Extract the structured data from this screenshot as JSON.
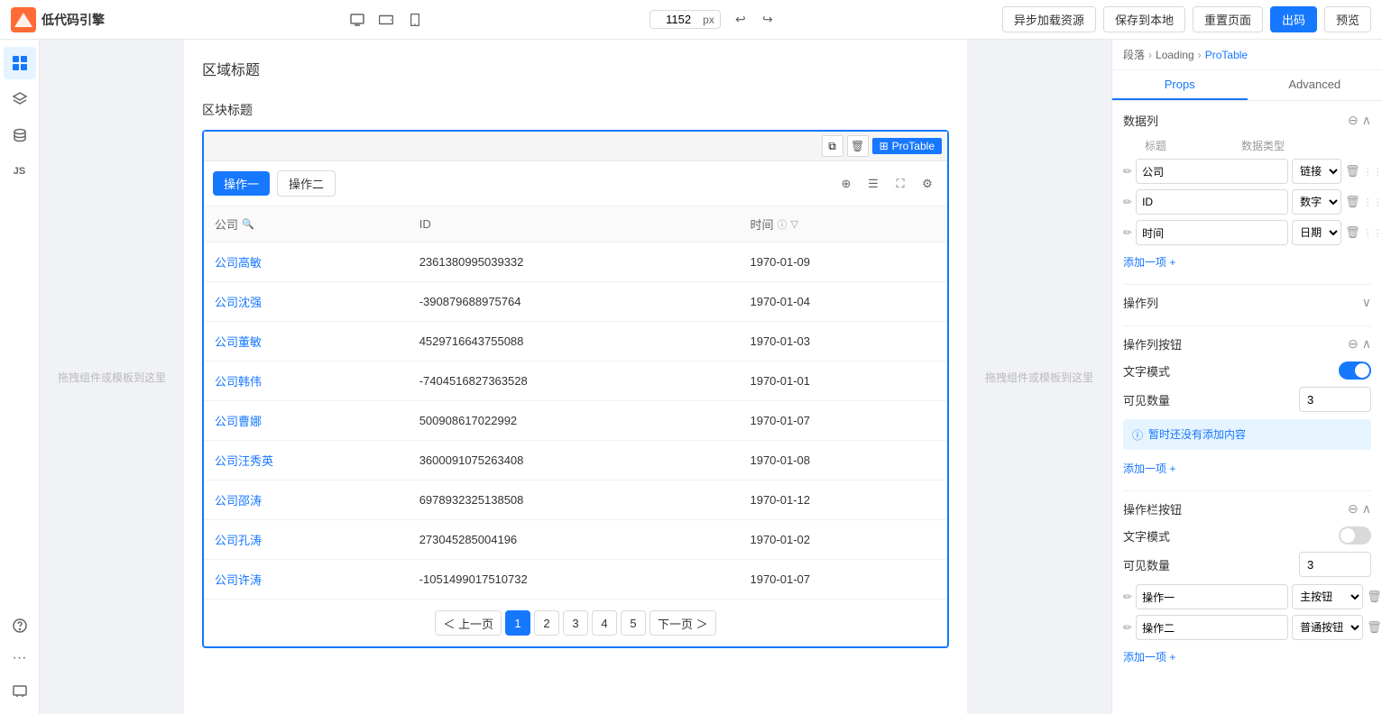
{
  "app": {
    "logo_text": "低代码引擎",
    "width_value": "1152",
    "width_unit": "px"
  },
  "toolbar": {
    "async_load": "异步加载资源",
    "save_local": "保存到本地",
    "reset_page": "重置页面",
    "export": "出码",
    "preview": "预览",
    "undo_icon": "↩",
    "redo_icon": "↪"
  },
  "breadcrumb": {
    "items": [
      "段落",
      "Loading",
      "ProTable"
    ]
  },
  "tabs": {
    "props": "Props",
    "advanced": "Advanced"
  },
  "canvas": {
    "drop_zone_text": "拖拽组件或模板到这里",
    "section_title": "区域标题",
    "block_title": "区块标题"
  },
  "pro_table": {
    "label": "ProTable",
    "btn1": "操作一",
    "btn2": "操作二",
    "columns": [
      {
        "key": "company",
        "title": "公司",
        "search": true
      },
      {
        "key": "id",
        "title": "ID"
      },
      {
        "key": "time",
        "title": "时间"
      }
    ],
    "rows": [
      {
        "company": "公司高敏",
        "id": "2361380995039332",
        "time": "1970-01-09"
      },
      {
        "company": "公司沈强",
        "id": "-390879688975764",
        "time": "1970-01-04"
      },
      {
        "company": "公司董敏",
        "id": "4529716643755088",
        "time": "1970-01-03"
      },
      {
        "company": "公司韩伟",
        "id": "-7404516827363528",
        "time": "1970-01-01"
      },
      {
        "company": "公司曹娜",
        "id": "500908617022992",
        "time": "1970-01-07"
      },
      {
        "company": "公司汪秀英",
        "id": "3600091075263408",
        "time": "1970-01-08"
      },
      {
        "company": "公司邵涛",
        "id": "6978932325138508",
        "time": "1970-01-12"
      },
      {
        "company": "公司孔涛",
        "id": "273045285004196",
        "time": "1970-01-02"
      },
      {
        "company": "公司许涛",
        "id": "-1051499017510732",
        "time": "1970-01-07"
      }
    ],
    "pagination": {
      "prev": "＜ 上一页",
      "next": "下一页 ＞",
      "pages": [
        "1",
        "2",
        "3",
        "4",
        "5"
      ],
      "active": "1"
    }
  },
  "right_panel": {
    "breadcrumb": [
      "段落",
      "Loading",
      "ProTable"
    ],
    "data_columns_title": "数据列",
    "col_header_title": "标题",
    "col_header_type": "数据类型",
    "columns": [
      {
        "title": "公司",
        "type": "链接"
      },
      {
        "title": "ID",
        "type": "数字"
      },
      {
        "title": "时间",
        "type": "日期"
      }
    ],
    "add_item": "添加一项 +",
    "action_col_title": "操作列",
    "action_btn_title": "操作列按钮",
    "text_mode_label": "文字模式",
    "visible_count_label": "可见数量",
    "visible_count_value1": "3",
    "no_content_text": "暂时还没有添加内容",
    "add_item2": "添加一项 +",
    "toolbar_btn_title": "操作栏按钮",
    "visible_count_value2": "3",
    "action_buttons": [
      {
        "label": "操作一",
        "type": "主按钮"
      },
      {
        "label": "操作二",
        "type": "普通按钮"
      }
    ],
    "add_item3": "添加一项 +"
  }
}
